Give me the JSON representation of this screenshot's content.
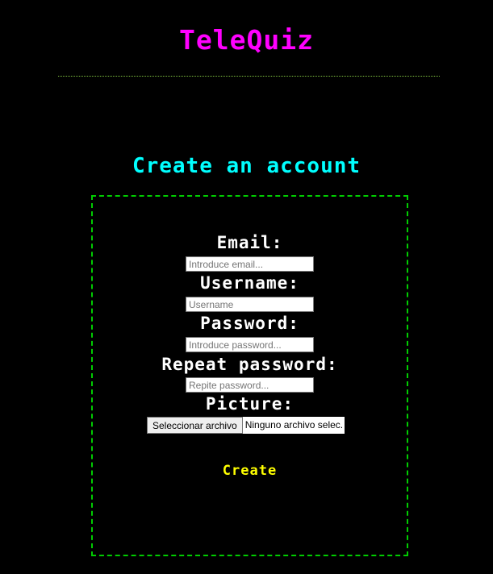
{
  "header": {
    "title": "TeleQuiz"
  },
  "form": {
    "heading": "Create an account",
    "fields": [
      {
        "label": "Email:",
        "placeholder": "Introduce email...",
        "value": ""
      },
      {
        "label": "Username:",
        "placeholder": "Username",
        "value": ""
      },
      {
        "label": "Password:",
        "placeholder": "Introduce password...",
        "value": ""
      },
      {
        "label": "Repeat password:",
        "placeholder": "Repite password...",
        "value": ""
      }
    ],
    "picture": {
      "label": "Picture:",
      "button_label": "Seleccionar archivo",
      "status": "Ninguno archivo selec."
    },
    "submit_label": "Create"
  },
  "colors": {
    "background": "#000000",
    "title": "#ff00ff",
    "heading": "#00ffff",
    "labels": "#ffffff",
    "submit": "#ffff00",
    "border": "#00cc00"
  }
}
